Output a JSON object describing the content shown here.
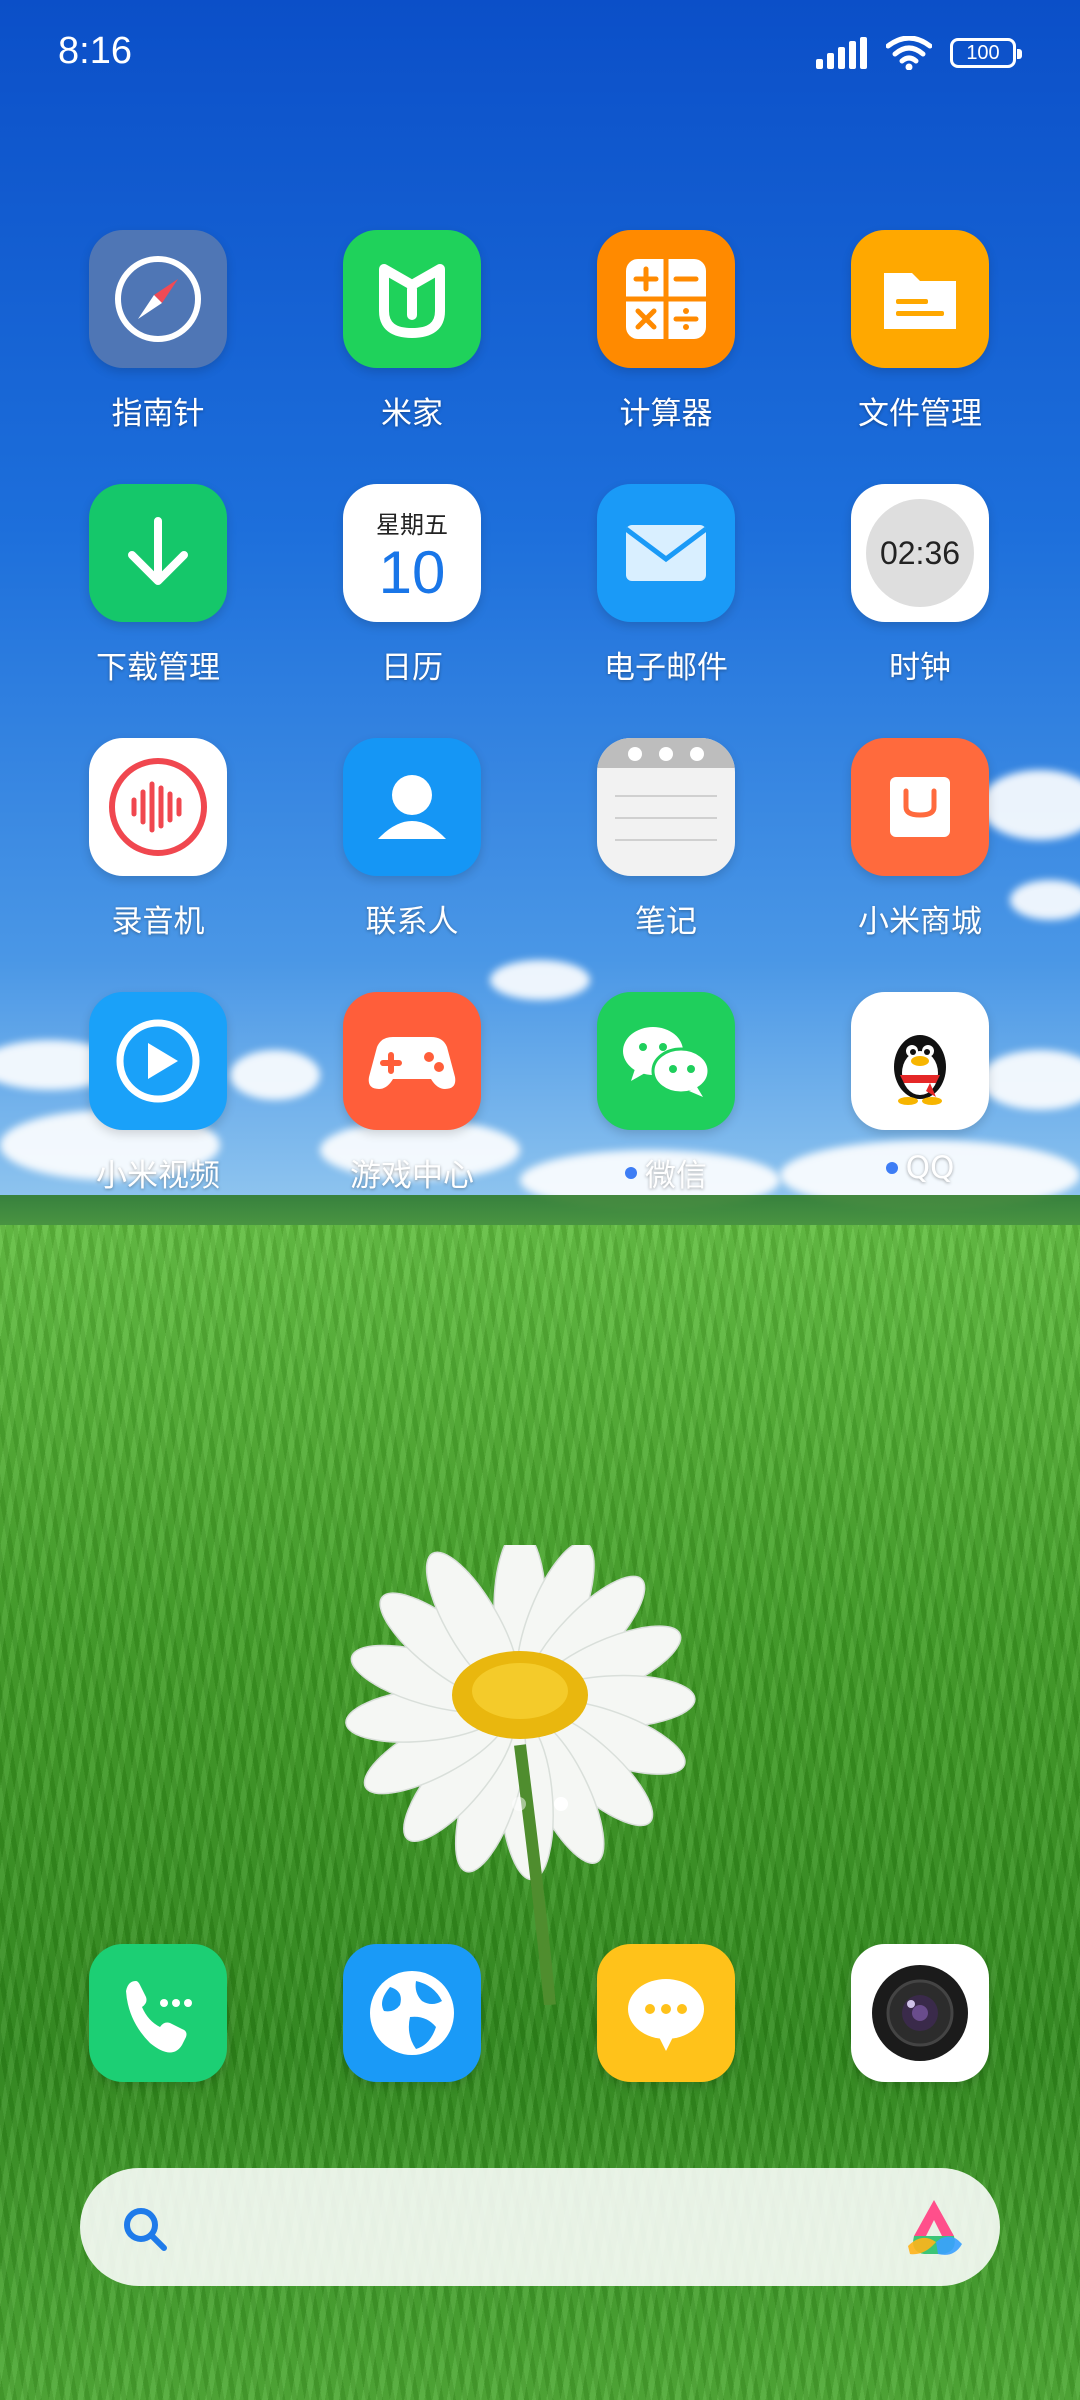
{
  "status_bar": {
    "time": "8:16",
    "battery": "100"
  },
  "apps": [
    {
      "label": "指南针",
      "icon": "compass-icon",
      "color": "#4f76b5"
    },
    {
      "label": "米家",
      "icon": "mijia-icon",
      "color": "#1fd25b"
    },
    {
      "label": "计算器",
      "icon": "calculator-icon",
      "color": "#ff8a00"
    },
    {
      "label": "文件管理",
      "icon": "folder-icon",
      "color": "#ffa800"
    },
    {
      "label": "下载管理",
      "icon": "download-icon",
      "color": "#15c76a"
    },
    {
      "label": "日历",
      "icon": "calendar-icon",
      "color": "#ffffff",
      "weekday": "星期五",
      "day": "10"
    },
    {
      "label": "电子邮件",
      "icon": "mail-icon",
      "color": "#1a9af7"
    },
    {
      "label": "时钟",
      "icon": "clock-icon",
      "color": "#ffffff",
      "time": "02:36"
    },
    {
      "label": "录音机",
      "icon": "recorder-icon",
      "color": "#ffffff"
    },
    {
      "label": "联系人",
      "icon": "contacts-icon",
      "color": "#1596f5"
    },
    {
      "label": "笔记",
      "icon": "notes-icon",
      "color": "#f2f2f2"
    },
    {
      "label": "小米商城",
      "icon": "mi-store-icon",
      "color": "#ff6a3d"
    },
    {
      "label": "小米视频",
      "icon": "video-play-icon",
      "color": "#1aa1f9"
    },
    {
      "label": "游戏中心",
      "icon": "gamepad-icon",
      "color": "#ff5e3a"
    },
    {
      "label": "微信",
      "icon": "wechat-icon",
      "color": "#1fcf5c",
      "new_badge": true
    },
    {
      "label": "QQ",
      "icon": "qq-penguin-icon",
      "color": "#ffffff",
      "new_badge": true
    }
  ],
  "dock": [
    {
      "name": "phone",
      "icon": "phone-icon",
      "color": "#1ccf74"
    },
    {
      "name": "browser",
      "icon": "globe-icon",
      "color": "#1a9af7"
    },
    {
      "name": "messages",
      "icon": "message-bubble-icon",
      "color": "#ffc21a"
    },
    {
      "name": "camera",
      "icon": "camera-icon",
      "color": "#ffffff"
    }
  ],
  "page_indicator": {
    "pages": 2,
    "active": 2
  },
  "search": {
    "placeholder": "",
    "search_icon": "search-icon",
    "assistant_icon": "ai-assistant-icon"
  }
}
